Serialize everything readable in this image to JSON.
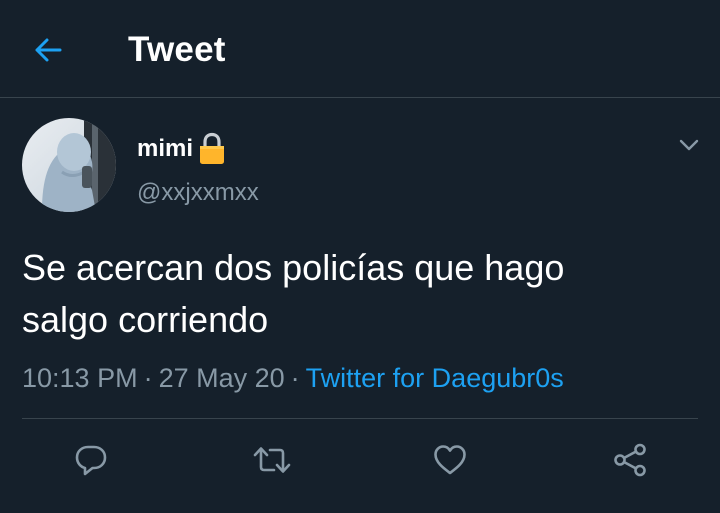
{
  "colors": {
    "background": "#15202b",
    "accent": "#1da1f2",
    "muted": "#8899a6",
    "divider": "#38444d",
    "text": "#ffffff"
  },
  "header": {
    "title": "Tweet",
    "back_icon": "arrow-left-icon"
  },
  "tweet": {
    "author": {
      "display_name": "mimi",
      "protected_icon": "lock-icon",
      "handle": "@xxjxxmxx"
    },
    "text": "Se acercan dos policías que hago\nsalgo corriendo",
    "time": "10:13 PM",
    "date": "27 May 20",
    "separator": "·",
    "source": "Twitter for Daegubr0s",
    "menu_icon": "chevron-down-icon"
  },
  "actions": [
    {
      "name": "reply",
      "icon": "reply-icon"
    },
    {
      "name": "retweet",
      "icon": "retweet-icon"
    },
    {
      "name": "like",
      "icon": "heart-icon"
    },
    {
      "name": "share",
      "icon": "share-icon"
    }
  ]
}
